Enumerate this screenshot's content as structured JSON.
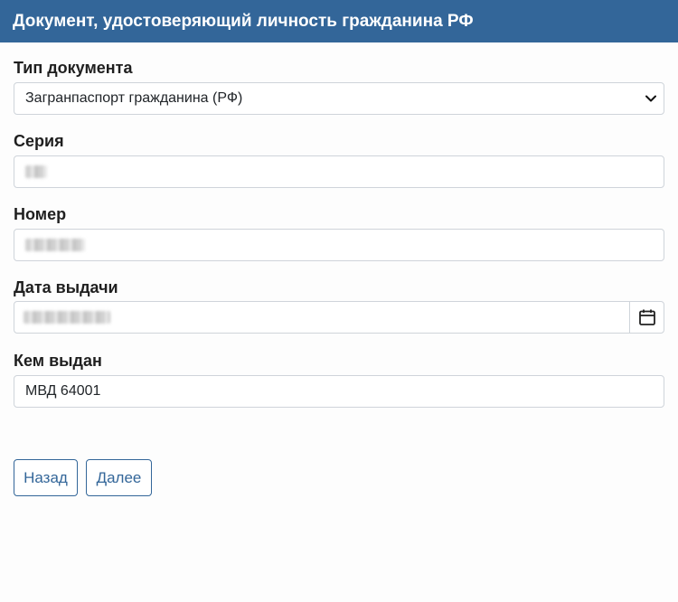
{
  "header": {
    "title": "Документ, удостоверяющий личность гражданина РФ"
  },
  "form": {
    "doc_type": {
      "label": "Тип документа",
      "value": "Загранпаспорт гражданина (РФ)"
    },
    "series": {
      "label": "Серия"
    },
    "number": {
      "label": "Номер"
    },
    "issue_date": {
      "label": "Дата выдачи"
    },
    "issued_by": {
      "label": "Кем выдан",
      "value": "МВД 64001"
    }
  },
  "buttons": {
    "back": "Назад",
    "next": "Далее"
  },
  "colors": {
    "header_bg": "#336699",
    "button_accent": "#336699"
  },
  "icons": {
    "select": "chevron-down-icon",
    "date": "calendar-icon"
  }
}
